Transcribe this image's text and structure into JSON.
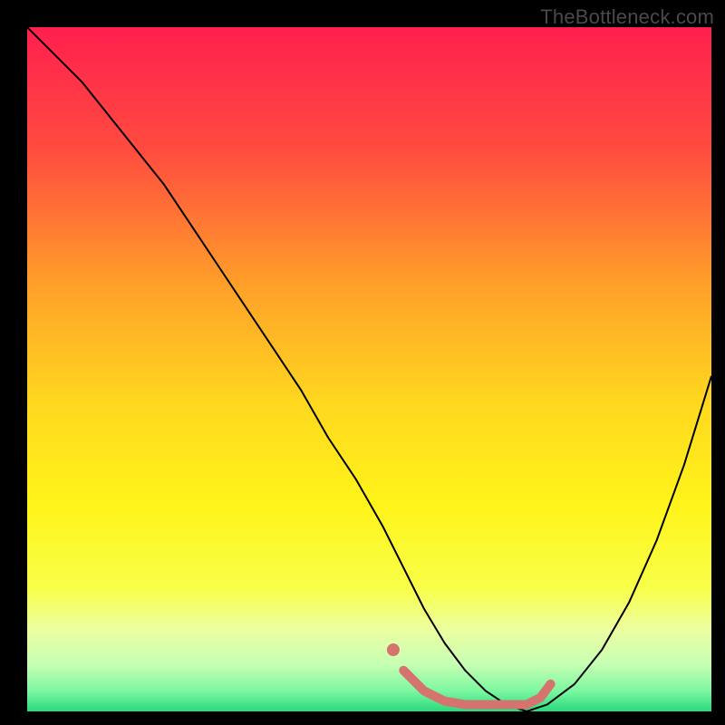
{
  "watermark": "TheBottleneck.com",
  "chart_data": {
    "type": "line",
    "title": "",
    "xlabel": "",
    "ylabel": "",
    "xlim": [
      0,
      100
    ],
    "ylim": [
      0,
      100
    ],
    "grid": false,
    "legend": false,
    "background_gradient_stops": [
      {
        "offset": 0.0,
        "color": "#ff1f4f"
      },
      {
        "offset": 0.18,
        "color": "#ff4c3f"
      },
      {
        "offset": 0.38,
        "color": "#ffa129"
      },
      {
        "offset": 0.55,
        "color": "#ffd81f"
      },
      {
        "offset": 0.7,
        "color": "#fff41a"
      },
      {
        "offset": 0.82,
        "color": "#f8ff4a"
      },
      {
        "offset": 0.88,
        "color": "#ecffa0"
      },
      {
        "offset": 0.93,
        "color": "#c8ffb4"
      },
      {
        "offset": 0.97,
        "color": "#7cf7a0"
      },
      {
        "offset": 1.0,
        "color": "#29d97d"
      }
    ],
    "series": [
      {
        "name": "bottleneck-curve",
        "stroke": "#000000",
        "stroke_width": 2,
        "x": [
          0,
          4,
          8,
          12,
          16,
          20,
          24,
          28,
          32,
          36,
          40,
          44,
          48,
          52,
          55,
          58,
          61,
          64,
          67,
          70,
          73,
          76,
          80,
          84,
          88,
          92,
          96,
          100
        ],
        "y": [
          100,
          96,
          92,
          87,
          82,
          77,
          71,
          65,
          59,
          53,
          47,
          40,
          34,
          27,
          21,
          15,
          10,
          6,
          3,
          1,
          0,
          1,
          4,
          9,
          16,
          25,
          36,
          49
        ]
      },
      {
        "name": "optimal-zone",
        "stroke": "#d5746f",
        "stroke_width": 10,
        "linecap": "round",
        "x": [
          55,
          58,
          61,
          64,
          67,
          70,
          73,
          75,
          76.5
        ],
        "y": [
          6,
          3,
          1.5,
          1,
          1,
          1,
          1,
          2,
          4
        ]
      },
      {
        "name": "optimal-dot",
        "type": "scatter",
        "fill": "#d5746f",
        "radius": 7,
        "x": [
          53.5
        ],
        "y": [
          9
        ]
      }
    ]
  }
}
